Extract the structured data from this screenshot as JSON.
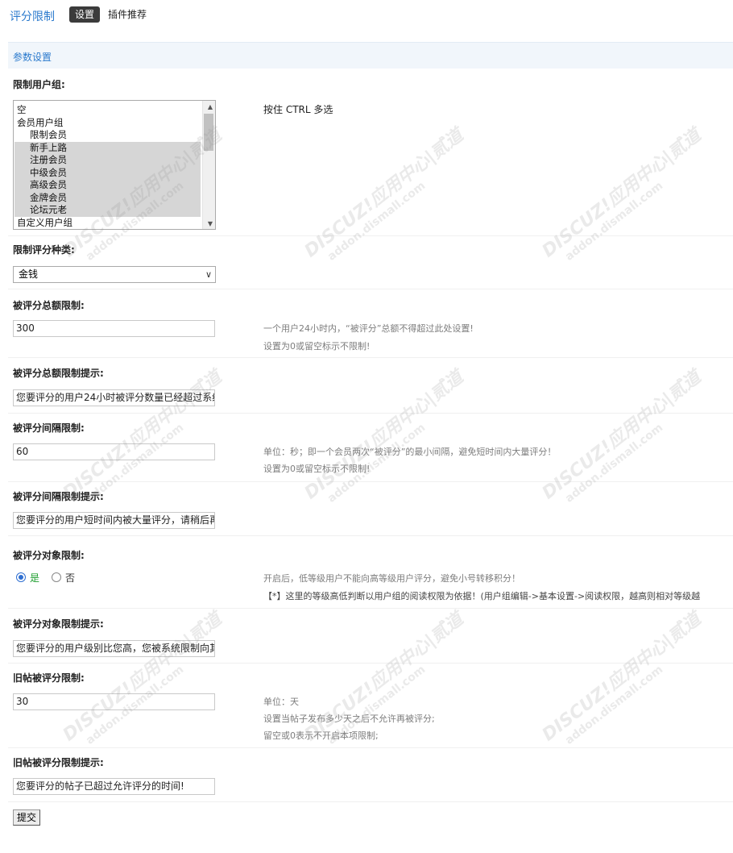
{
  "header": {
    "app_title": "评分限制",
    "tabs": [
      "设置",
      "插件推荐"
    ]
  },
  "section_title": "参数设置",
  "fields": {
    "groups": {
      "label": "限制用户组:",
      "hint": "按住 CTRL 多选",
      "options": [
        {
          "label": "空",
          "type": "group",
          "selected": false
        },
        {
          "label": "会员用户组",
          "type": "group",
          "selected": false
        },
        {
          "label": "限制会员",
          "type": "child",
          "selected": false
        },
        {
          "label": "新手上路",
          "type": "child",
          "selected": true
        },
        {
          "label": "注册会员",
          "type": "child",
          "selected": true
        },
        {
          "label": "中级会员",
          "type": "child",
          "selected": true
        },
        {
          "label": "高级会员",
          "type": "child",
          "selected": true
        },
        {
          "label": "金牌会员",
          "type": "child",
          "selected": true
        },
        {
          "label": "论坛元老",
          "type": "child",
          "selected": true
        },
        {
          "label": "自定义用户组",
          "type": "group",
          "selected": false
        }
      ]
    },
    "credit_type": {
      "label": "限制评分种类:",
      "value": "金钱"
    },
    "total_limit": {
      "label": "被评分总额限制:",
      "value": "300",
      "tips": [
        "一个用户24小时内，“被评分”总额不得超过此处设置!",
        "设置为0或留空标示不限制!"
      ]
    },
    "total_limit_msg": {
      "label": "被评分总额限制提示:",
      "value": "您要评分的用户24小时被评分数量已经超过系统"
    },
    "interval_limit": {
      "label": "被评分间隔限制:",
      "value": "60",
      "tips": [
        "单位：秒；即一个会员两次“被评分”的最小间隔，避免短时间内大量评分！",
        "设置为0或留空标示不限制!"
      ]
    },
    "interval_limit_msg": {
      "label": "被评分间隔限制提示:",
      "value": "您要评分的用户短时间内被大量评分，请稍后再"
    },
    "target_limit": {
      "label": "被评分对象限制:",
      "options": [
        "是",
        "否"
      ],
      "selected": "是",
      "tips": [
        "开启后，低等级用户不能向高等级用户评分，避免小号转移积分！",
        "【*】这里的等级高低判断以用户组的阅读权限为依据！(用户组编辑->基本设置->阅读权限，越高则相对等级越"
      ]
    },
    "target_limit_msg": {
      "label": "被评分对象限制提示:",
      "value": "您要评分的用户级别比您高，您被系统限制向其"
    },
    "old_thread_limit": {
      "label": "旧帖被评分限制:",
      "value": "30",
      "tips": [
        "单位：天",
        "设置当帖子发布多少天之后不允许再被评分;",
        "留空或0表示不开启本项限制;"
      ]
    },
    "old_thread_limit_msg": {
      "label": "旧帖被评分限制提示:",
      "value": "您要评分的帖子已超过允许评分的时间!"
    }
  },
  "submit_label": "提交",
  "watermark": {
    "line1": "DISCUZ!应用中心|贰道",
    "line2": "addon.dismall.com"
  },
  "colors": {
    "accent": "#2b7acd",
    "yes": "#1c9d2d"
  }
}
